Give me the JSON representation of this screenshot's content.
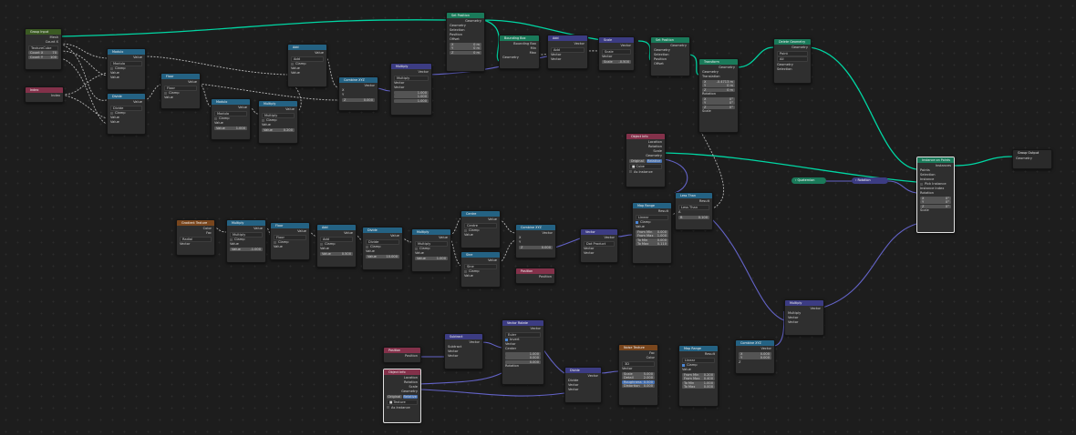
{
  "nodes": {
    "group_input": {
      "title": "Group Input",
      "mesh": "Mesh",
      "count_x_label": "Count X",
      "count_y_label": "Count Y",
      "tex": "TextureCube",
      "cx": "Count X",
      "cx_v": "70",
      "cy": "Count Y",
      "cy_v": "100"
    },
    "index": {
      "title": "Index",
      "out": "Index"
    },
    "modulo": {
      "title": "Modulo",
      "out": "Value",
      "op": "Modulo",
      "clamp": "Clamp",
      "a": "Value",
      "b": "Value"
    },
    "divide1": {
      "title": "Divide",
      "out": "Value",
      "op": "Divide",
      "clamp": "Clamp",
      "a": "Value",
      "b": "Value"
    },
    "floor1": {
      "title": "Floor",
      "out": "Value",
      "op": "Floor",
      "clamp": "Clamp",
      "a": "Value"
    },
    "modulo2": {
      "title": "Modulo",
      "out": "Value",
      "op": "Modulo",
      "clamp": "Clamp",
      "a": "Value",
      "b": "Value",
      "bv": "1.000"
    },
    "multiply1": {
      "title": "Multiply",
      "out": "Value",
      "op": "Multiply",
      "clamp": "Clamp",
      "a": "Value",
      "b": "Value",
      "bv": "0.200"
    },
    "add1": {
      "title": "Add",
      "out": "Value",
      "op": "Add",
      "clamp": "Clamp",
      "a": "Value",
      "b": "Value"
    },
    "combine_xyz1": {
      "title": "Combine XYZ",
      "out": "Vector",
      "x": "X",
      "y": "Y",
      "z": "Z",
      "zv": "0.000"
    },
    "multiply_vec1": {
      "title": "Multiply",
      "out": "Vector",
      "op": "Multiply",
      "a": "Vector",
      "b": "Vector",
      "v1": "1.000",
      "v2": "1.000",
      "v3": "1.000"
    },
    "set_position1": {
      "title": "Set Position",
      "out": "Geometry",
      "g": "Geometry",
      "sel": "Selection",
      "pos": "Position",
      "off": "Offset",
      "x": "X",
      "xv": "0 m",
      "y": "Y",
      "yv": "0 m",
      "z": "Z",
      "zv": "0 m"
    },
    "bounding_box": {
      "title": "Bounding Box",
      "bb": "Bounding Box",
      "min": "Min",
      "max": "Max",
      "g": "Geometry"
    },
    "add_vec": {
      "title": "Add",
      "out": "Vector",
      "op": "Add",
      "a": "Vector",
      "b": "Vector"
    },
    "scale_vec": {
      "title": "Scale",
      "out": "Vector",
      "op": "Scale",
      "a": "Vector",
      "s": "Scale",
      "sv": "-0.500"
    },
    "set_position2": {
      "title": "Set Position",
      "out": "Geometry",
      "g": "Geometry",
      "sel": "Selection",
      "pos": "Position",
      "off": "Offset"
    },
    "transform": {
      "title": "Transform",
      "out": "Geometry",
      "g": "Geometry",
      "t": "Translation",
      "tx": "X",
      "txv": "-0.4713 m",
      "ty": "Y",
      "tyv": "0 m",
      "tz": "Z",
      "tzv": "0 m",
      "r": "Rotation",
      "rx": "X",
      "rxv": "0°",
      "ry": "Y",
      "ryv": "0°",
      "rz": "Z",
      "rzv": "0°",
      "sc": "Scale"
    },
    "delete_geo": {
      "title": "Delete Geometry",
      "out": "Geometry",
      "m1": "Point",
      "m2": "All",
      "g": "Geometry",
      "sel": "Selection"
    },
    "object_info1": {
      "title": "Object Info",
      "loc": "Location",
      "rot": "Rotation",
      "scl": "Scale",
      "geo": "Geometry",
      "orig": "Original",
      "rel": "Relative",
      "obj": "Cube",
      "asi": "As Instance"
    },
    "instance_on_points": {
      "title": "Instance on Points",
      "out": "Instances",
      "pts": "Points",
      "sel": "Selection",
      "inst": "Instance",
      "pick": "Pick Instance",
      "idx": "Instance Index",
      "rot": "Rotation",
      "rx": "X",
      "rxv": "0°",
      "ry": "Y",
      "ryv": "0°",
      "rz": "Z",
      "rzv": "0°",
      "scl": "Scale"
    },
    "group_output": {
      "title": "Group Output",
      "g": "Geometry"
    },
    "quaternion": {
      "title": "Quaternion"
    },
    "rotation_to": {
      "title": "Rotation"
    },
    "gradient_tex": {
      "title": "Gradient Texture",
      "color": "Color",
      "fac": "Fac",
      "type": "Radial",
      "vec": "Vector"
    },
    "multiply2": {
      "title": "Multiply",
      "out": "Value",
      "op": "Multiply",
      "clamp": "Clamp",
      "a": "Value",
      "b": "Value",
      "bv": "-1.000"
    },
    "floor2": {
      "title": "Floor",
      "out": "Value",
      "op": "Floor",
      "clamp": "Clamp",
      "a": "Value"
    },
    "add2": {
      "title": "Add",
      "out": "Value",
      "op": "Add",
      "clamp": "Clamp",
      "a": "Value",
      "b": "Value",
      "bv": "0.500"
    },
    "divide2": {
      "title": "Divide",
      "out": "Value",
      "op": "Divide",
      "clamp": "Clamp",
      "a": "Value",
      "b": "Value",
      "bv": "10.000"
    },
    "multiply3": {
      "title": "Multiply",
      "out": "Value",
      "op": "Multiply",
      "clamp": "Clamp",
      "a": "Value",
      "b": "Value",
      "bv": "1.000"
    },
    "combine_xyz2": {
      "title": "Combine XYZ",
      "out": "Vector",
      "x": "X",
      "y": "Y",
      "z": "Z",
      "zv": "0.000"
    },
    "vector_math_lerp": {
      "title": "Vector",
      "out": "Vector",
      "op": "Dot Product",
      "a": "Vector",
      "b": "Vector"
    },
    "map_range1": {
      "title": "Map Range",
      "out": "Result",
      "type": "Linear",
      "clamp": "Clamp",
      "v": "Value",
      "fmin": "From Min",
      "fminv": "0.000",
      "fmax": "From Max",
      "fmaxv": "1.000",
      "tmin": "To Min",
      "tminv": "0.000",
      "tmax": "To Max",
      "tmaxv": "0.110"
    },
    "less_than": {
      "title": "Less Than",
      "out": "Result",
      "op": "Less Than",
      "a": "A",
      "b": "B",
      "bv": "0.100"
    },
    "centre_c": {
      "title": "Centre",
      "out": "Value",
      "op": "Centre",
      "clamp": "Clamp",
      "a": "Value",
      "b": "Value"
    },
    "sine": {
      "title": "Sine",
      "out": "Value",
      "op": "Sine",
      "clamp": "Clamp",
      "a": "Value"
    },
    "position1": {
      "title": "Position",
      "out": "Position"
    },
    "multiply_vec2": {
      "title": "Multiply",
      "out": "Vector",
      "op": "Multiply",
      "a": "Vector",
      "b": "Vector"
    },
    "position2": {
      "title": "Position",
      "out": "Position"
    },
    "object_info2": {
      "title": "Object Info",
      "loc": "Location",
      "rot": "Rotation",
      "scl": "Scale",
      "geo": "Geometry",
      "orig": "Original",
      "rel": "Relative",
      "obj": "Texture",
      "asi": "As Instance"
    },
    "subtract": {
      "title": "Subtract",
      "out": "Vector",
      "op": "Subtract",
      "a": "Vector",
      "b": "Vector"
    },
    "vector_rotate": {
      "title": "Vector Rotate",
      "out": "Vector",
      "type": "Euler",
      "inv": "Invert",
      "v": "Vector",
      "c": "Center",
      "cx": "1.000",
      "cy": "0.000",
      "cz": "0.000",
      "rot": "Rotation"
    },
    "divide_vec": {
      "title": "Divide",
      "out": "Vector",
      "op": "Divide",
      "a": "Vector",
      "b": "Vector"
    },
    "noise_tex": {
      "title": "Noise Texture",
      "fac": "Fac",
      "color": "Color",
      "dim": "3D",
      "vec": "Vector",
      "scale": "Scale",
      "scalev": "5.000",
      "detail": "Detail",
      "detailv": "2.000",
      "rough": "Roughness",
      "roughv": "0.500",
      "dist": "Distortion",
      "distv": "0.000"
    },
    "map_range2": {
      "title": "Map Range",
      "out": "Result",
      "type": "Linear",
      "clamp": "Clamp",
      "v": "Value",
      "fmin": "From Min",
      "fminv": "0.200",
      "fmax": "From Max",
      "fmaxv": "0.400",
      "tmin": "To Min",
      "tminv": "1.000",
      "tmax": "To Max",
      "tmaxv": "0.000"
    },
    "combine_xyz3": {
      "title": "Combine XYZ",
      "out": "Vector",
      "x": "X",
      "xv": "0.000",
      "y": "Y",
      "yv": "0.000",
      "z": "Z"
    }
  },
  "colors": {
    "geometry": "#00d6a3",
    "float": "#a1a1a1",
    "vector": "#6363c7",
    "background": "#1d1d1d"
  }
}
